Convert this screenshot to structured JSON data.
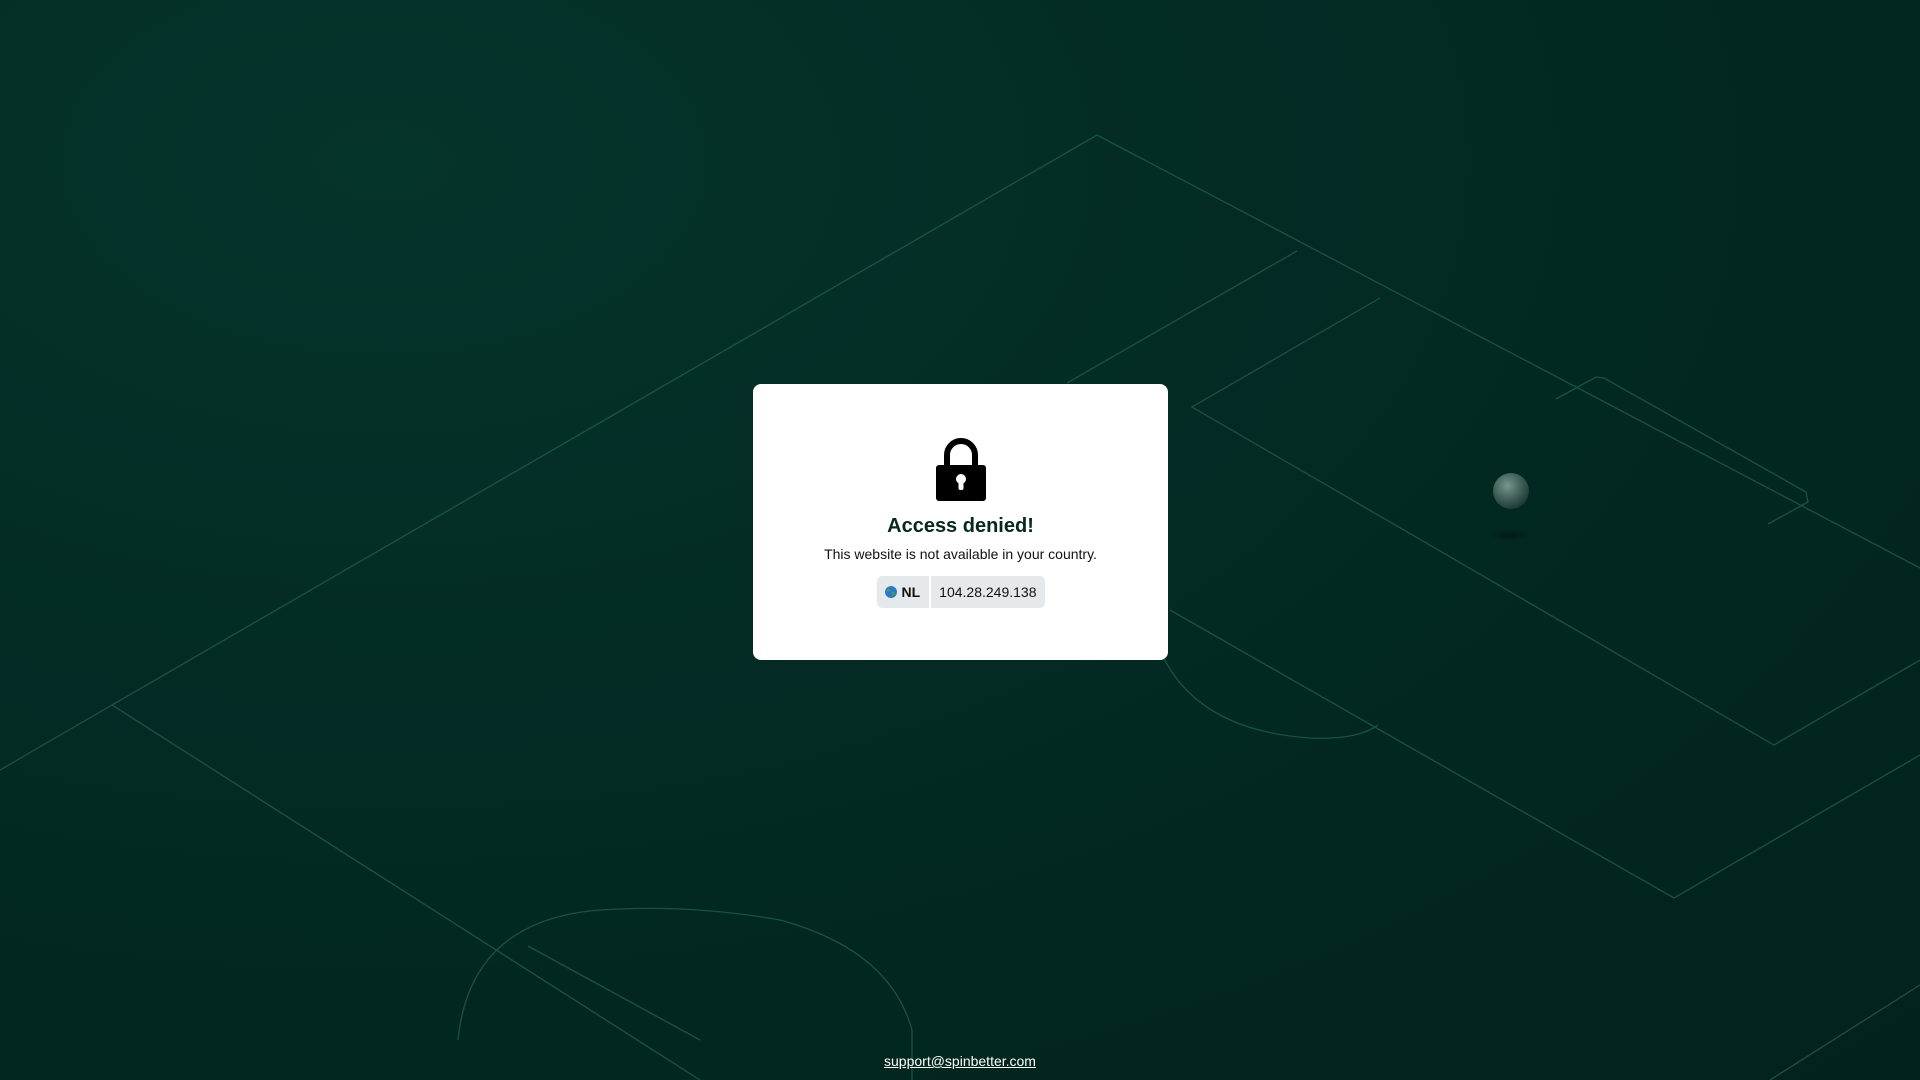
{
  "modal": {
    "title": "Access denied!",
    "message": "This website is not available in your country.",
    "country_code": "NL",
    "ip_address": "104.28.249.138"
  },
  "footer": {
    "support_email": "support@spinbetter.com"
  },
  "icons": {
    "lock": "lock-icon",
    "globe": "globe-icon"
  },
  "colors": {
    "background": "#032b24",
    "field_lines": "#1d5a4c",
    "modal_background": "#ffffff",
    "title_color": "#06281f",
    "pill_background": "#e6e9ec",
    "link_color": "#ffffff"
  }
}
